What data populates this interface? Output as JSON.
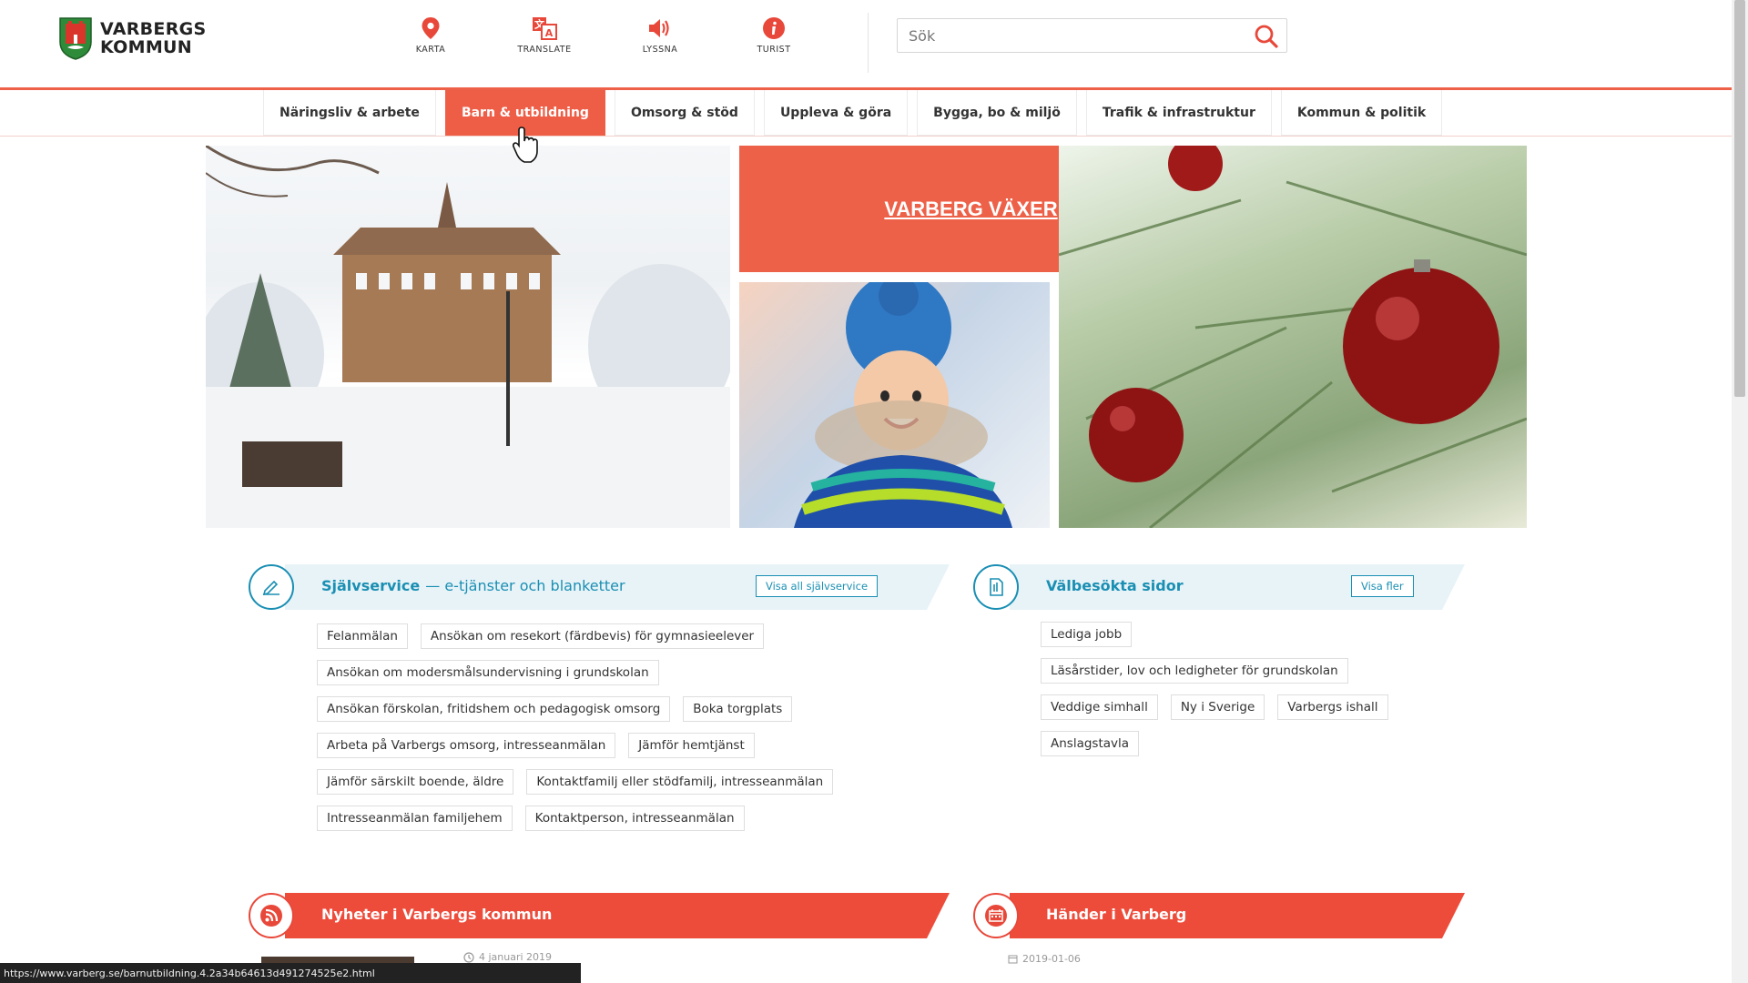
{
  "brand": {
    "line1": "VARBERGS",
    "line2": "KOMMUN",
    "accent": "#ee6149",
    "blue": "#1a8fb3"
  },
  "tools": [
    {
      "label": "KARTA",
      "icon": "map-pin-icon"
    },
    {
      "label": "TRANSLATE",
      "icon": "translate-icon"
    },
    {
      "label": "LYSSNA",
      "icon": "speaker-icon"
    },
    {
      "label": "TURIST",
      "icon": "info-icon"
    }
  ],
  "search": {
    "placeholder": "Sök",
    "icon": "search-icon"
  },
  "nav": [
    {
      "label": "Näringsliv & arbete"
    },
    {
      "label": "Barn & utbildning",
      "active": true
    },
    {
      "label": "Omsorg & stöd"
    },
    {
      "label": "Uppleva & göra"
    },
    {
      "label": "Bygga, bo & miljö"
    },
    {
      "label": "Trafik & infrastruktur"
    },
    {
      "label": "Kommun & politik"
    }
  ],
  "hero": {
    "banner_label": "VARBERG VÄXER"
  },
  "selfservice": {
    "title": "Självservice",
    "subtitle": "— e-tjänster och blanketter",
    "button": "Visa all självservice",
    "rows": [
      [
        "Felanmälan",
        "Ansökan om resekort (färdbevis) för gymnasieelever"
      ],
      [
        "Ansökan om modersmålsundervisning i grundskolan"
      ],
      [
        "Ansökan förskolan, fritidshem och pedagogisk omsorg",
        "Boka torgplats"
      ],
      [
        "Arbeta på Varbergs omsorg, intresseanmälan",
        "Jämför hemtjänst"
      ],
      [
        "Jämför särskilt boende, äldre",
        "Kontaktfamilj eller stödfamilj, intresseanmälan"
      ],
      [
        "Intresseanmälan familjehem",
        "Kontaktperson, intresseanmälan"
      ]
    ]
  },
  "popular": {
    "title": "Välbesökta sidor",
    "button": "Visa fler",
    "rows": [
      [
        "Lediga jobb"
      ],
      [
        "Läsårstider, lov och ledigheter för grundskolan"
      ],
      [
        "Veddige simhall",
        "Ny i Sverige",
        "Varbergs ishall"
      ],
      [
        "Anslagstavla"
      ]
    ]
  },
  "news": {
    "title": "Nyheter i Varbergs kommun",
    "date": "4 januari 2019"
  },
  "events": {
    "title": "Händer i Varberg",
    "date": "2019-01-06"
  },
  "statusbar": {
    "url": "https://www.varberg.se/barnutbildning.4.2a34b64613d491274525e2.html"
  }
}
